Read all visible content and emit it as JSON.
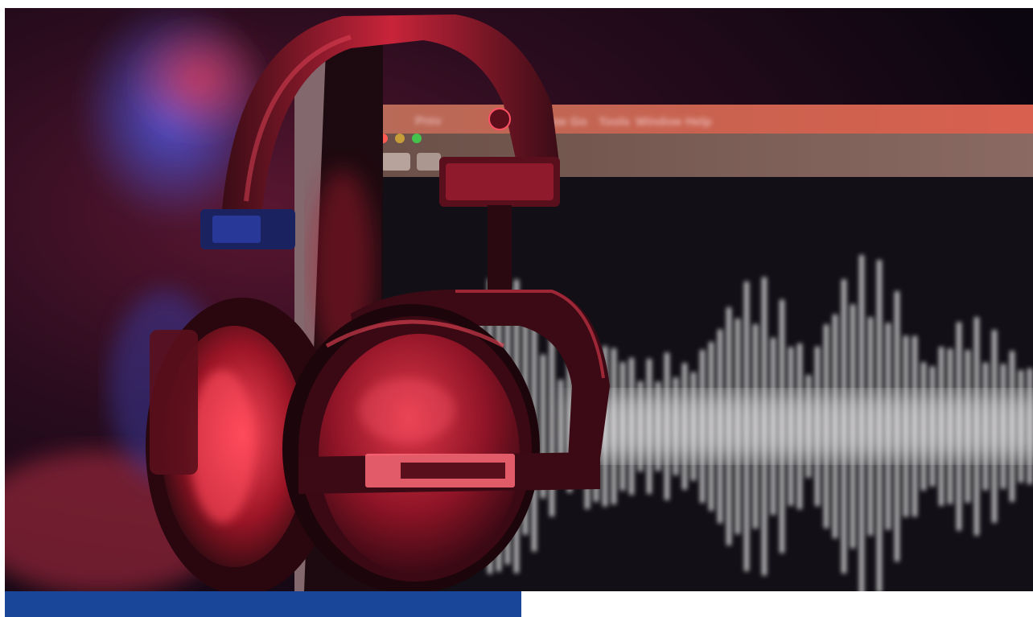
{
  "photo": {
    "subject": "studio-headphones-on-monitor",
    "palette": {
      "background": "#0e0812",
      "accent_red": "#d3203a",
      "accent_blue": "#2c4fd6",
      "waveform": "#d9d9d9",
      "footer_bar": "#1a4699"
    },
    "screen_menu": [
      "Prev",
      "View",
      "Go",
      "Tools",
      "Window",
      "Help"
    ]
  }
}
